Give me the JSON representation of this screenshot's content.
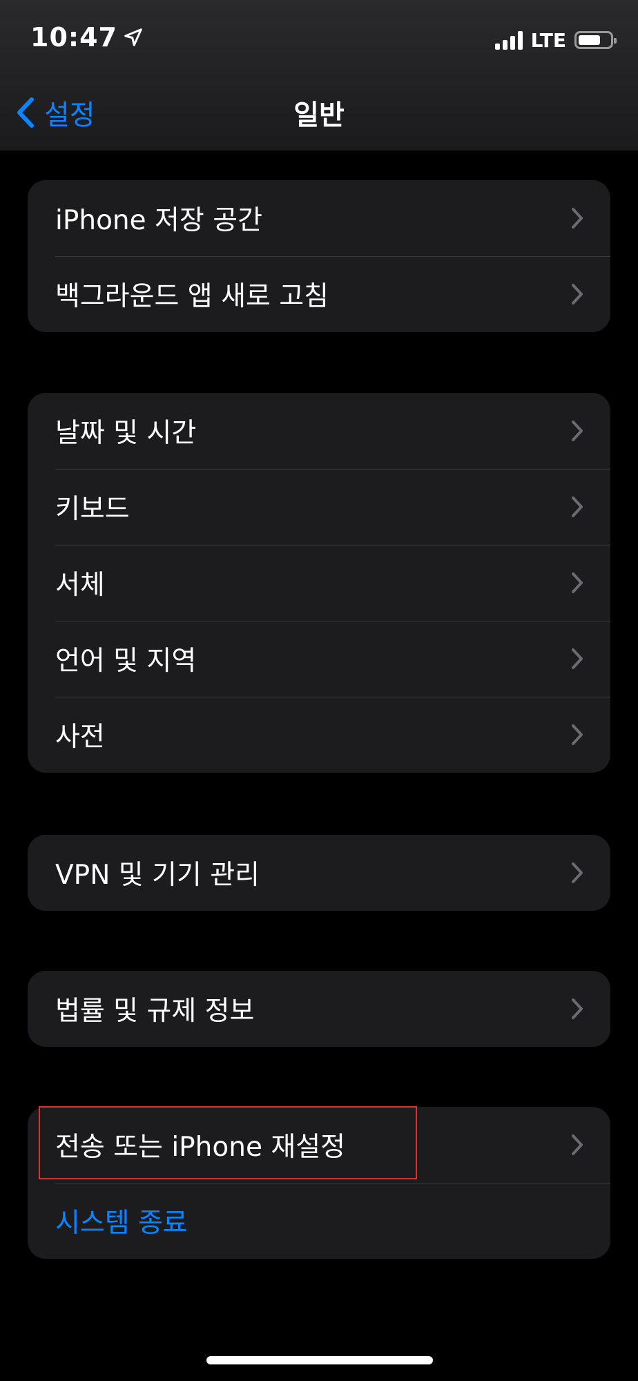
{
  "status_bar": {
    "time": "10:47",
    "network": "LTE",
    "battery_level": 0.7
  },
  "nav": {
    "back_label": "설정",
    "title": "일반"
  },
  "groups": [
    {
      "items": [
        {
          "label": "iPhone 저장 공간"
        },
        {
          "label": "백그라운드 앱 새로 고침"
        }
      ]
    },
    {
      "items": [
        {
          "label": "날짜 및 시간"
        },
        {
          "label": "키보드"
        },
        {
          "label": "서체"
        },
        {
          "label": "언어 및 지역"
        },
        {
          "label": "사전"
        }
      ]
    },
    {
      "items": [
        {
          "label": "VPN 및 기기 관리"
        }
      ]
    },
    {
      "items": [
        {
          "label": "법률 및 규제 정보"
        }
      ]
    },
    {
      "items": [
        {
          "label": "전송 또는 iPhone 재설정"
        },
        {
          "label": "시스템 종료"
        }
      ]
    }
  ],
  "colors": {
    "accent": "#0a84ff",
    "cell_background": "#1c1c1e",
    "highlight": "#e0302a"
  }
}
